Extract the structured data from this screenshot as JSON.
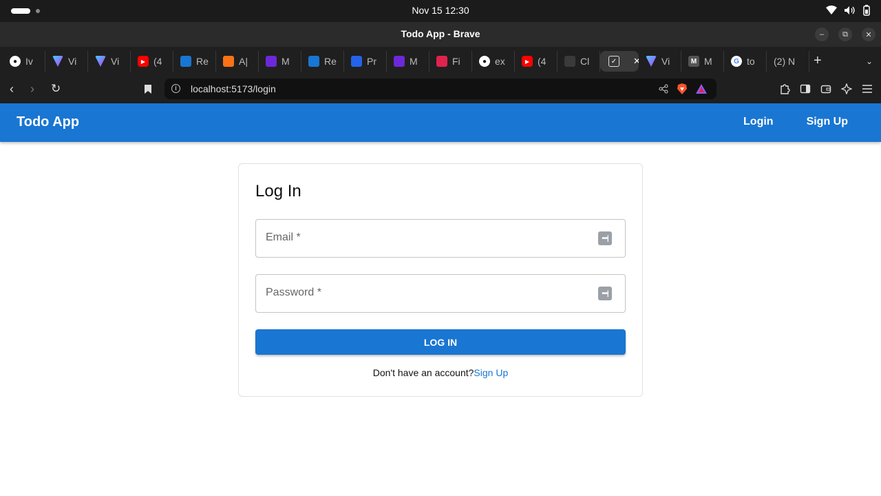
{
  "os": {
    "clock": "Nov 15  12:30"
  },
  "window": {
    "title": "Todo App - Brave"
  },
  "tabs": [
    {
      "label": "Iv",
      "icon": "github-icon",
      "color": "#2b2b2b"
    },
    {
      "label": "Vi",
      "icon": "vite-icon",
      "color": "#8b5cf6"
    },
    {
      "label": "Vi",
      "icon": "vite-icon",
      "color": "#8b5cf6"
    },
    {
      "label": "(4",
      "icon": "youtube-icon",
      "color": "#ff0000"
    },
    {
      "label": "Re",
      "icon": "mui-icon",
      "color": "#1976d2"
    },
    {
      "label": "A|",
      "icon": "orange-square-icon",
      "color": "#f97316"
    },
    {
      "label": "M",
      "icon": "purple-list-icon",
      "color": "#6d28d9"
    },
    {
      "label": "Re",
      "icon": "mui-icon",
      "color": "#1976d2"
    },
    {
      "label": "Pr",
      "icon": "docs-icon",
      "color": "#2563eb"
    },
    {
      "label": "M",
      "icon": "purple-list-icon",
      "color": "#6d28d9"
    },
    {
      "label": "Fi",
      "icon": "nestjs-icon",
      "color": "#e0234e"
    },
    {
      "label": "ex",
      "icon": "github-icon",
      "color": "#2b2b2b"
    },
    {
      "label": "(4",
      "icon": "youtube-icon",
      "color": "#ff0000"
    },
    {
      "label": "Cl",
      "icon": "openai-icon",
      "color": "#3a3a3a"
    },
    {
      "label": "",
      "icon": "checkbox-icon",
      "color": "#3a3a3a",
      "active": true
    },
    {
      "label": "Vi",
      "icon": "vite-icon",
      "color": "#8b5cf6"
    },
    {
      "label": "M",
      "icon": "medium-icon",
      "color": "#555555"
    },
    {
      "label": "to",
      "icon": "google-icon",
      "color": "#ffffff"
    },
    {
      "label": "(2) N",
      "icon": "",
      "color": ""
    }
  ],
  "browser": {
    "url": "localhost:5173/login"
  },
  "app": {
    "title": "Todo App",
    "nav": {
      "login": "Login",
      "signup": "Sign Up"
    }
  },
  "login": {
    "title": "Log In",
    "email_label": "Email *",
    "password_label": "Password *",
    "submit": "LOG IN",
    "prompt": "Don't have an account?",
    "signup_link": "Sign Up"
  },
  "colors": {
    "primary": "#1976d2"
  }
}
